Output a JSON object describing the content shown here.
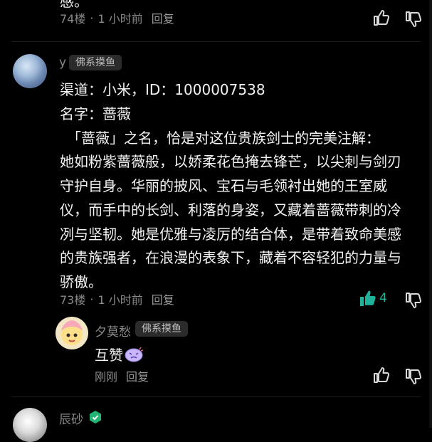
{
  "top_comment": {
    "partial_text": "感。",
    "floor": "74楼",
    "time": "1 小时前",
    "reply_label": "回复"
  },
  "comment": {
    "username": "y",
    "badge": "佛系摸鱼",
    "lines": [
      "渠道：小米，ID：1000007538",
      "名字：蔷薇",
      "　「蔷薇」之名，恰是对这位贵族剑士的完美注解：",
      "她如粉紫蔷薇般，以娇柔花色掩去锋芒，以尖刺与剑刃",
      "守护自身。华丽的披风、宝石与毛领衬出她的王室威",
      "仪，而手中的长剑、利落的身姿，又藏着蔷薇带刺的冷",
      "冽与坚韧。她是优雅与凌厉的结合体，是带着致命美感",
      "的贵族强者，在浪漫的表象下，藏着不容轻犯的力量与",
      "骄傲。"
    ],
    "floor": "73楼",
    "time": "1 小时前",
    "reply_label": "回复",
    "like_count": "4",
    "liked": true
  },
  "reply": {
    "username": "夕莫愁",
    "badge": "佛系摸鱼",
    "text": "互赞",
    "time": "刚刚",
    "reply_label": "回复"
  },
  "next_comment": {
    "username": "辰砂"
  },
  "colors": {
    "background": "#000000",
    "text_primary": "#f2f2f2",
    "text_muted": "#8a8a8a",
    "like_active": "#1fb39c",
    "badge_bg": "#2b2b2b"
  },
  "icons": {
    "like": "thumb-up-icon",
    "dislike": "thumb-down-icon",
    "liked": "thumb-up-filled-icon",
    "level": "level-badge-icon",
    "sticker": "sticker-emoji-icon"
  }
}
